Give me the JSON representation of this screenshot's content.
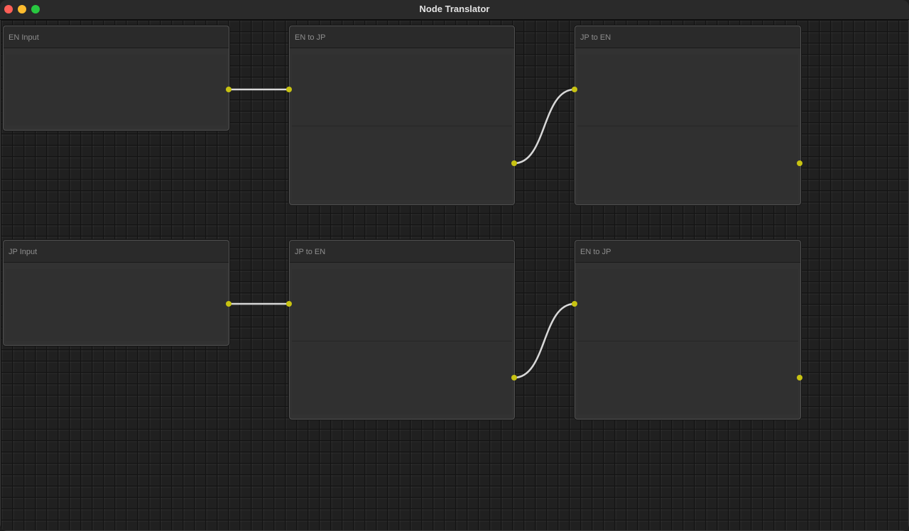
{
  "window": {
    "title": "Node Translator"
  },
  "colors": {
    "port": "#c8c312",
    "wire": "#d8d8d8",
    "canvas": "#202020",
    "node": "#323232"
  },
  "nodes": [
    {
      "id": "en_input",
      "title": "EN Input"
    },
    {
      "id": "en_to_jp_1",
      "title": "EN to JP"
    },
    {
      "id": "jp_to_en_1",
      "title": "JP to EN"
    },
    {
      "id": "jp_input",
      "title": "JP Input"
    },
    {
      "id": "jp_to_en_2",
      "title": "JP to EN"
    },
    {
      "id": "en_to_jp_2",
      "title": "EN to JP"
    }
  ],
  "connections": [
    {
      "from": "en_input",
      "to": "en_to_jp_1"
    },
    {
      "from": "en_to_jp_1",
      "to": "jp_to_en_1"
    },
    {
      "from": "jp_input",
      "to": "jp_to_en_2"
    },
    {
      "from": "jp_to_en_2",
      "to": "en_to_jp_2"
    }
  ]
}
